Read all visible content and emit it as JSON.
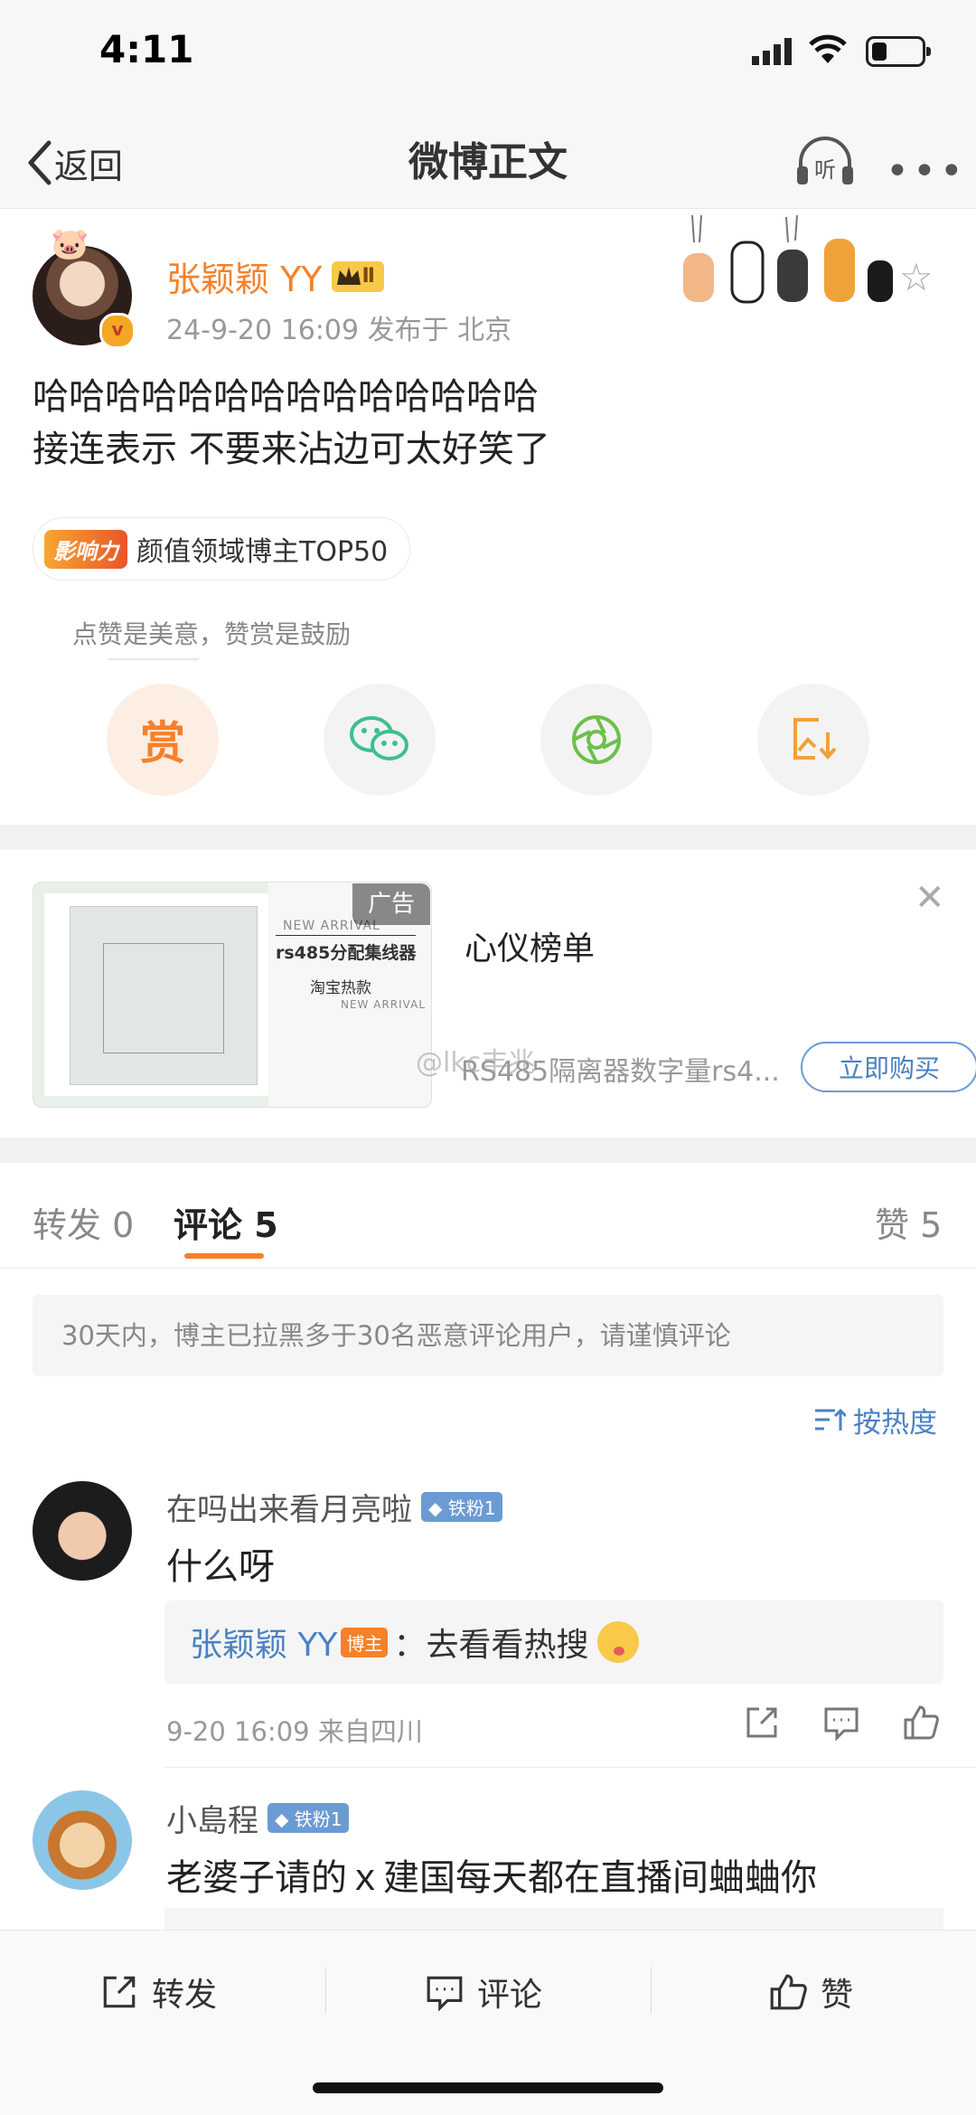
{
  "status_bar": {
    "time": "4:11"
  },
  "nav": {
    "back_label": "返回",
    "title": "微博正文",
    "listen_label": "听"
  },
  "post": {
    "author": "张颖颖 YY",
    "crown_level": "Ⅱ",
    "meta": "24-9-20 16:09  发布于 北京",
    "text": "哈哈哈哈哈哈哈哈哈哈哈哈哈哈\n接连表示 不要来沾边可太好笑了",
    "influence_badge": "影响力",
    "influence_text": "颜值领域博主TOP50",
    "tip_note": "点赞是美意，赞赏是鼓励",
    "reward_label": "赏"
  },
  "ad": {
    "tag": "广告",
    "title": "心仪榜单",
    "image_text_1": "NEW ARRIVAL",
    "image_text_2": "rs485分配集线器",
    "image_text_3": "淘宝热款",
    "image_text_4": "NEW ARRIVAL",
    "description": "RS485隔离器数字量rs4...",
    "watermark": "@lkc丰兆",
    "buy_label": "立即购买"
  },
  "tabs": {
    "repost": "转发 0",
    "comment": "评论 5",
    "like": "赞 5"
  },
  "notice": "30天内，博主已拉黑多于30名恶意评论用户，请谨慎评论",
  "sort_label": "按热度",
  "comments": [
    {
      "name": "在吗出来看月亮啦",
      "fan_badge": "铁粉1",
      "text": "什么呀",
      "reply_name": "张颖颖 YY",
      "reply_badge": "博主",
      "reply_text": "：去看看热搜",
      "time": "9-20 16:09  来自四川"
    },
    {
      "name": "小島程",
      "fan_badge": "铁粉1",
      "text": "老婆子请的ｘ建国每天都在直播间蛐蛐你"
    }
  ],
  "bottom": {
    "repost": "转发",
    "comment": "评论",
    "like": "赞"
  },
  "colors": {
    "accent": "#f5812a",
    "link": "#4a82c4",
    "fan_badge": "#6b9bd2"
  }
}
